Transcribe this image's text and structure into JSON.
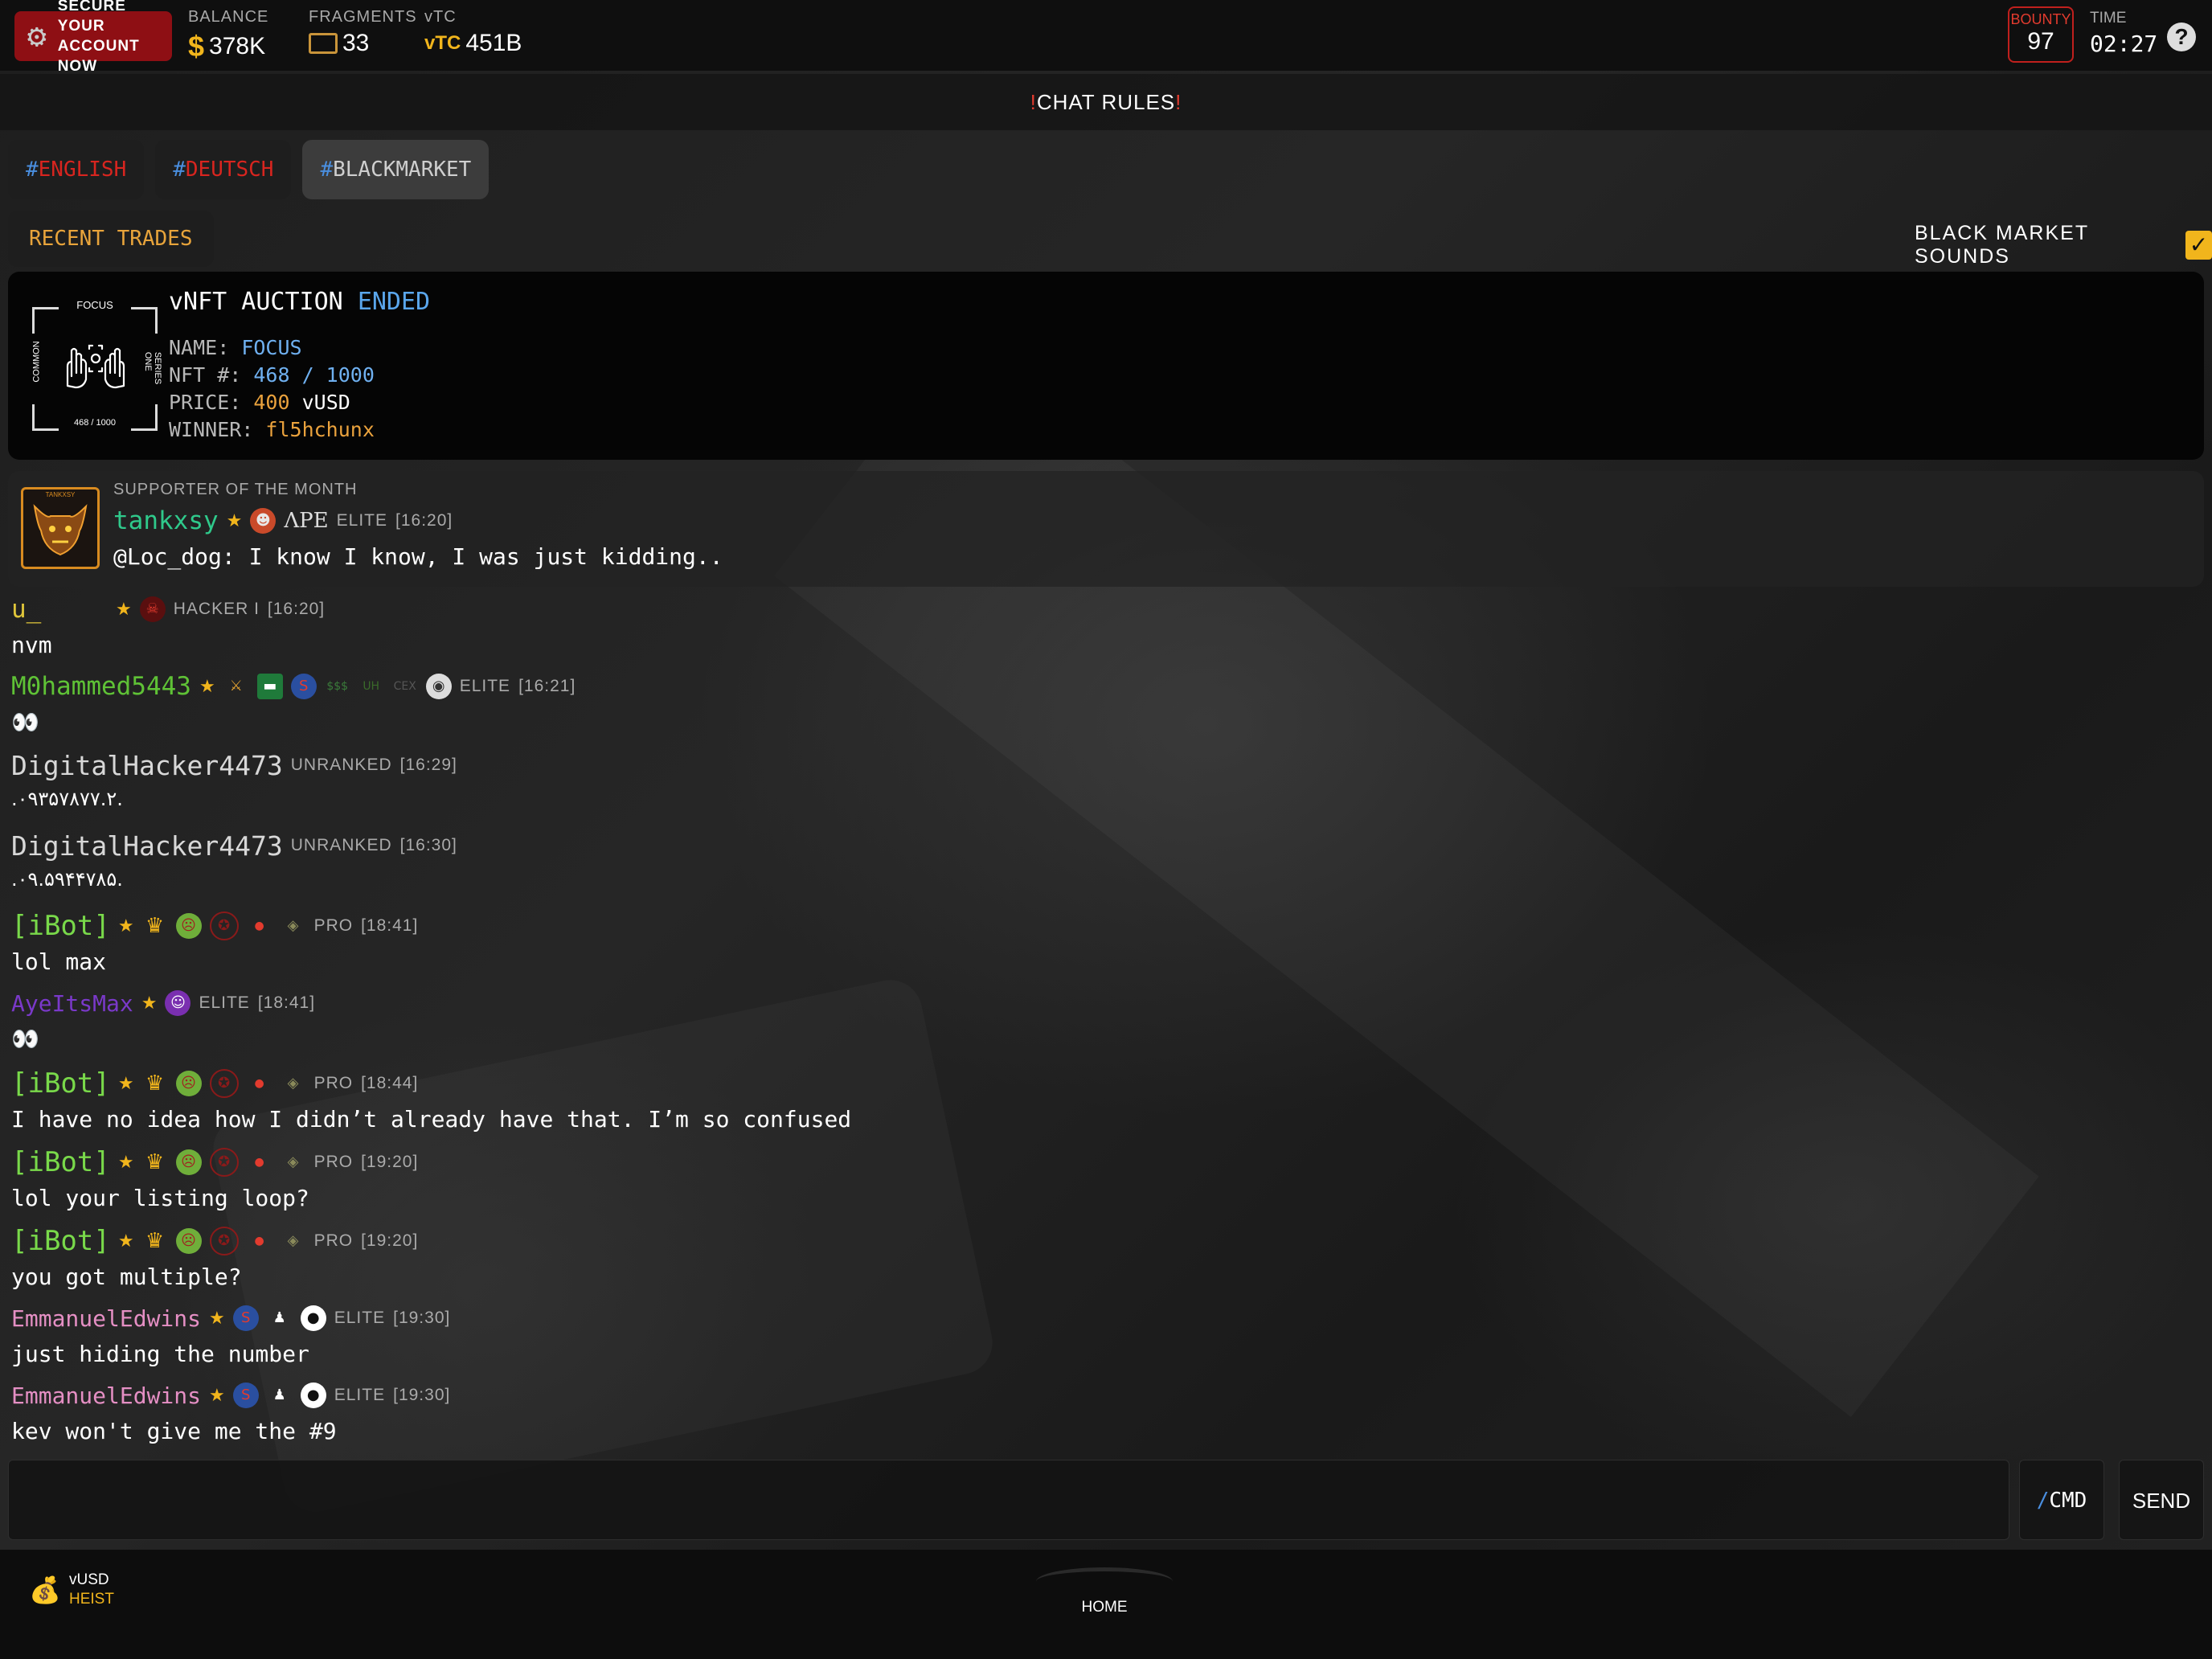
{
  "header": {
    "secure_line1": "SECURE YOUR",
    "secure_line2": "ACCOUNT NOW",
    "balance_label": "BALANCE",
    "balance_value": "378K",
    "fragments_label": "FRAGMENTS",
    "fragments_value": "33",
    "vtc_label": "vTC",
    "vtc_value": "451B",
    "bounty_label": "BOUNTY",
    "bounty_value": "97",
    "time_label": "TIME",
    "time_value": "02:27",
    "help_icon": "?"
  },
  "chat_rules": "CHAT RULES",
  "tabs": [
    {
      "hash": "#",
      "name": "ENGLISH"
    },
    {
      "hash": "#",
      "name": "DEUTSCH"
    },
    {
      "hash": "#",
      "name": "BLACKMARKET"
    }
  ],
  "recent_trades": "RECENT TRADES",
  "sounds_label": "BLACK MARKET SOUNDS",
  "sounds_checked": true,
  "auction": {
    "title": "vNFT AUCTION",
    "status": "ENDED",
    "card_title": "FOCUS",
    "card_left": "COMMON",
    "card_right": "SERIES ONE",
    "card_bottom": "468 / 1000",
    "name_label": "NAME:",
    "name_value": "FOCUS",
    "nft_label": "NFT #:",
    "nft_value": "468 / 1000",
    "price_label": "PRICE:",
    "price_value": "400",
    "price_unit": "vUSD",
    "winner_label": "WINNER:",
    "winner_value": "fl5hchunx"
  },
  "supporter": {
    "label": "SUPPORTER OF THE MONTH",
    "avatar_label": "TANKXSY",
    "username": "tankxsy",
    "ape_tag": "ΛPE",
    "rank": "ELITE",
    "time": "[16:20]",
    "message": "@Loc_dog: I know I know, I was just kidding.."
  },
  "messages": [
    {
      "user": "u_",
      "color": "#e0c63a",
      "rank": "HACKER I",
      "time": "[16:20]",
      "text": "nvm"
    },
    {
      "user": "M0hammed5443",
      "color": "#5fc236",
      "rank": "ELITE",
      "time": "[16:21]",
      "text": "👀"
    },
    {
      "user": "DigitalHacker4473",
      "color": "#d8d8d8",
      "rank": "UNRANKED",
      "time": "[16:29]",
      "text": ".۰۹۳۵۷۸۷۷.۲."
    },
    {
      "user": "DigitalHacker4473",
      "color": "#d8d8d8",
      "rank": "UNRANKED",
      "time": "[16:30]",
      "text": ".۰۹.۵۹۴۴۷۸۵."
    },
    {
      "user": "[iBot]",
      "color": "#79d94a",
      "rank": "PRO",
      "time": "[18:41]",
      "text": "lol max"
    },
    {
      "user": "AyeItsMax",
      "color": "#7a39c9",
      "rank": "ELITE",
      "time": "[18:41]",
      "text": "👀"
    },
    {
      "user": "[iBot]",
      "color": "#79d94a",
      "rank": "PRO",
      "time": "[18:44]",
      "text": "I have no idea how I didn’t already have that. I’m so confused"
    },
    {
      "user": "[iBot]",
      "color": "#79d94a",
      "rank": "PRO",
      "time": "[19:20]",
      "text": "lol your listing loop?"
    },
    {
      "user": "[iBot]",
      "color": "#79d94a",
      "rank": "PRO",
      "time": "[19:20]",
      "text": "you got multiple?"
    },
    {
      "user": "EmmanuelEdwins",
      "color": "#e58fc4",
      "rank": "ELITE",
      "time": "[19:30]",
      "text": "just hiding the number"
    },
    {
      "user": "EmmanuelEdwins",
      "color": "#e58fc4",
      "rank": "ELITE",
      "time": "[19:30]",
      "text": "kev won't give me the #9"
    }
  ],
  "input": {
    "placeholder": "",
    "cmd_slash": "/",
    "cmd_label": "CMD",
    "send_label": "SEND"
  },
  "footer": {
    "heist_line1": "vUSD",
    "heist_line2": "HEIST",
    "home_label": "HOME"
  }
}
